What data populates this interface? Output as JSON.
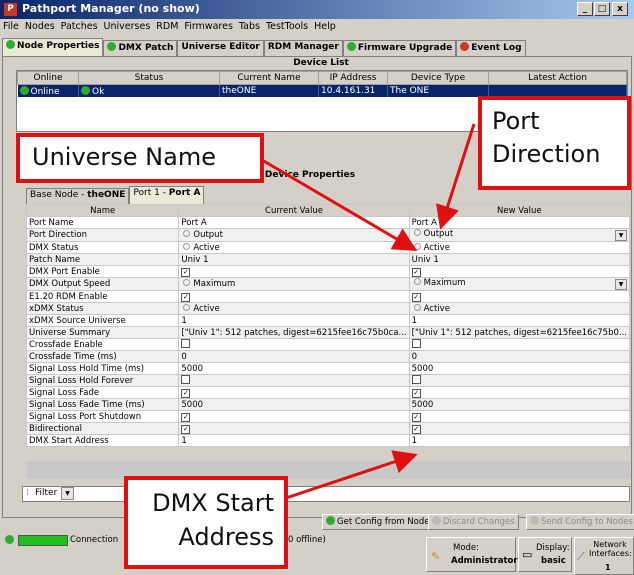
{
  "window": {
    "title": "Pathport Manager (no show)",
    "buttons": [
      "_",
      "□",
      "x"
    ]
  },
  "menu": [
    "File",
    "Nodes",
    "Patches",
    "Universes",
    "RDM",
    "Firmwares",
    "Tabs",
    "TestTools",
    "Help"
  ],
  "tabs": [
    {
      "label": "Node Properties",
      "icon": "green-check-icon",
      "active": true
    },
    {
      "label": "DMX Patch",
      "icon": "green-check-icon"
    },
    {
      "label": "Universe Editor"
    },
    {
      "label": "RDM Manager",
      "icon": "green-check-icon"
    },
    {
      "label": "Firmware Upgrade",
      "icon": "green-check-icon"
    },
    {
      "label": "Event Log",
      "icon": "red-warning-icon"
    }
  ],
  "device_list": {
    "title": "Device List",
    "columns": [
      "Online",
      "Status",
      "Current Name",
      "IP Address",
      "Device Type",
      "Latest Action"
    ],
    "rows": [
      [
        "Online",
        "Ok",
        "theONE",
        "10.4.161.31",
        "The ONE",
        ""
      ]
    ]
  },
  "device_properties": {
    "title": "Device Properties",
    "subtabs": [
      {
        "prefix": "Base Node - ",
        "bold": "theONE"
      },
      {
        "prefix": "Port 1 - ",
        "bold": "Port A",
        "active": true
      }
    ],
    "columns": [
      "Name",
      "Current Value",
      "New Value"
    ],
    "rows": [
      {
        "name": "Port Name",
        "current": "Port A",
        "new": "Port A"
      },
      {
        "name": "Port Direction",
        "current": "Output",
        "new": "Output",
        "kind": "radio-dd"
      },
      {
        "name": "DMX Status",
        "current": "Active",
        "new": "Active",
        "kind": "radio"
      },
      {
        "name": "Patch Name",
        "current": "Univ 1",
        "new": "Univ 1"
      },
      {
        "name": "DMX Port Enable",
        "current": "true",
        "new": "true",
        "kind": "check"
      },
      {
        "name": "DMX Output Speed",
        "current": "Maximum",
        "new": "Maximum",
        "kind": "radio-dd"
      },
      {
        "name": "E1.20 RDM Enable",
        "current": "true",
        "new": "true",
        "kind": "check"
      },
      {
        "name": "xDMX Status",
        "current": "Active",
        "new": "Active",
        "kind": "radio"
      },
      {
        "name": "xDMX Source Universe",
        "current": "1",
        "new": "1"
      },
      {
        "name": "Universe Summary",
        "current": "[\"Univ 1\": 512 patches, digest=6215fee16c75b0ca...",
        "new": "[\"Univ 1\": 512 patches, digest=6215fee16c75b0..."
      },
      {
        "name": "Crossfade Enable",
        "current": "false",
        "new": "false",
        "kind": "check"
      },
      {
        "name": "Crossfade Time (ms)",
        "current": "0",
        "new": "0"
      },
      {
        "name": "Signal Loss Hold Time (ms)",
        "current": "5000",
        "new": "5000"
      },
      {
        "name": "Signal Loss Hold Forever",
        "current": "false",
        "new": "false",
        "kind": "check"
      },
      {
        "name": "Signal Loss Fade",
        "current": "true",
        "new": "true",
        "kind": "check"
      },
      {
        "name": "Signal Loss Fade Time (ms)",
        "current": "5000",
        "new": "5000"
      },
      {
        "name": "Signal Loss Port Shutdown",
        "current": "true",
        "new": "true",
        "kind": "check"
      },
      {
        "name": "Bidirectional",
        "current": "true",
        "new": "true",
        "kind": "check"
      },
      {
        "name": "DMX Start Address",
        "current": "1",
        "new": "1"
      }
    ]
  },
  "filter": {
    "label": "Filter"
  },
  "actions": {
    "get_config": "Get Config from Nodes",
    "discard": "Discard Changes",
    "send": "Send Config to Nodes"
  },
  "statusbar": {
    "connection": "Connection",
    "connection_suffix": "0 offline)",
    "mode_label": "Mode:",
    "mode_value": "Administrator",
    "display_label": "Display:",
    "display_value": "basic",
    "network_label": "Network Interfaces:",
    "network_value": "1"
  },
  "callouts": {
    "universe_name": "Universe Name",
    "port_direction": [
      "Port",
      "Direction"
    ],
    "dmx_start": [
      "DMX Start",
      "Address"
    ]
  },
  "colors": {
    "callout": "#e01010",
    "selection": "#0a246a",
    "ok_green": "#2eaa2e"
  }
}
